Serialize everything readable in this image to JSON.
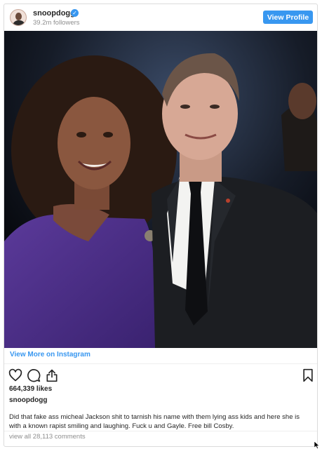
{
  "header": {
    "username": "snoopdogg",
    "followers": "39.2m followers",
    "view_profile_label": "View Profile"
  },
  "post": {
    "view_more_label": "View More on Instagram",
    "likes": "664,339 likes",
    "caption_username": "snoopdogg",
    "caption_text": "Did that fake ass micheal Jackson shit to tarnish his name with them lying ass kids and here she is with a known rapist smiling and laughing. Fuck u and Gayle. Free bill Cosby.",
    "comments_link": "view all 28,113 comments"
  },
  "icons": [
    "verified-badge-icon",
    "heart-icon",
    "comment-icon",
    "share-icon",
    "bookmark-icon",
    "cursor-icon"
  ],
  "colors": {
    "accent_blue": "#3897f0",
    "text": "#262626",
    "muted": "#8e8e8e",
    "border": "#dbdbdb"
  }
}
